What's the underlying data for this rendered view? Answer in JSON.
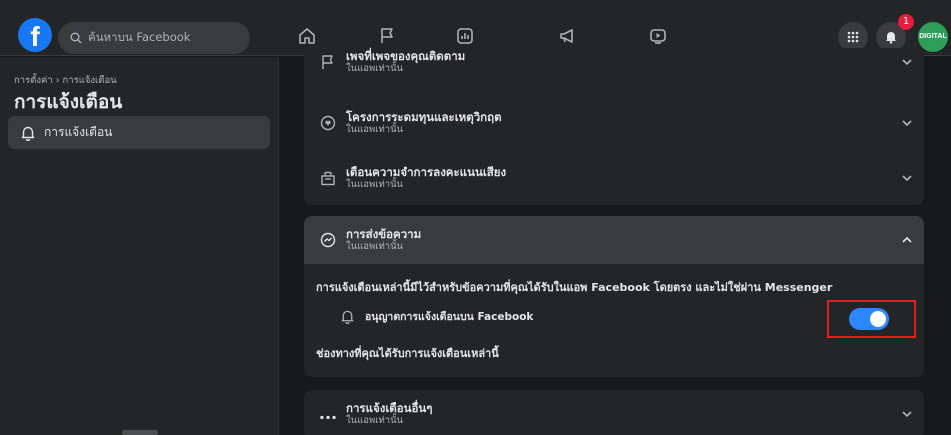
{
  "topbar": {
    "logo": "f",
    "search_placeholder": "ค้นหาบน Facebook",
    "notification_count": "1",
    "avatar_text": "DIGITAL"
  },
  "sidebar": {
    "breadcrumb": "การตั้งค่า › การแจ้งเตือน",
    "title": "การแจ้งเตือน",
    "items": [
      {
        "label": "การแจ้งเตือน",
        "icon": "bell-icon",
        "selected": true
      }
    ]
  },
  "sections": {
    "pages_following": {
      "title": "เพจที่เพจของคุณติดตาม",
      "subtitle": "ในแอพเท่านั้น",
      "icon": "flag-icon"
    },
    "fundraisers": {
      "title": "โครงการระดมทุนและเหตุวิกฤต",
      "subtitle": "ในแอพเท่านั้น",
      "icon": "heart-hands-icon"
    },
    "vote_reminders": {
      "title": "เตือนความจำการลงคะแนนเสียง",
      "subtitle": "ในแอพเท่านั้น",
      "icon": "ballot-box-icon"
    },
    "messaging": {
      "title": "การส่งข้อความ",
      "subtitle": "ในแอพเท่านั้น",
      "icon": "messenger-icon",
      "description": "การแจ้งเตือนเหล่านี้มีไว้สำหรับข้อความที่คุณได้รับในแอพ Facebook โดยตรง และไม่ใช่ผ่าน Messenger",
      "allow_label": "อนุญาตการแจ้งเตือนบน Facebook",
      "allow_enabled": true,
      "channels_label": "ช่องทางที่คุณได้รับการแจ้งเตือนเหล่านี้"
    },
    "other": {
      "title": "การแจ้งเตือนอื่นๆ",
      "subtitle": "ในแอพเท่านั้น",
      "icon": "more-dots-icon",
      "glyph": "..."
    }
  },
  "colors": {
    "accent": "#2d88ff",
    "highlight": "#e02020",
    "brand": "#1877f2"
  }
}
